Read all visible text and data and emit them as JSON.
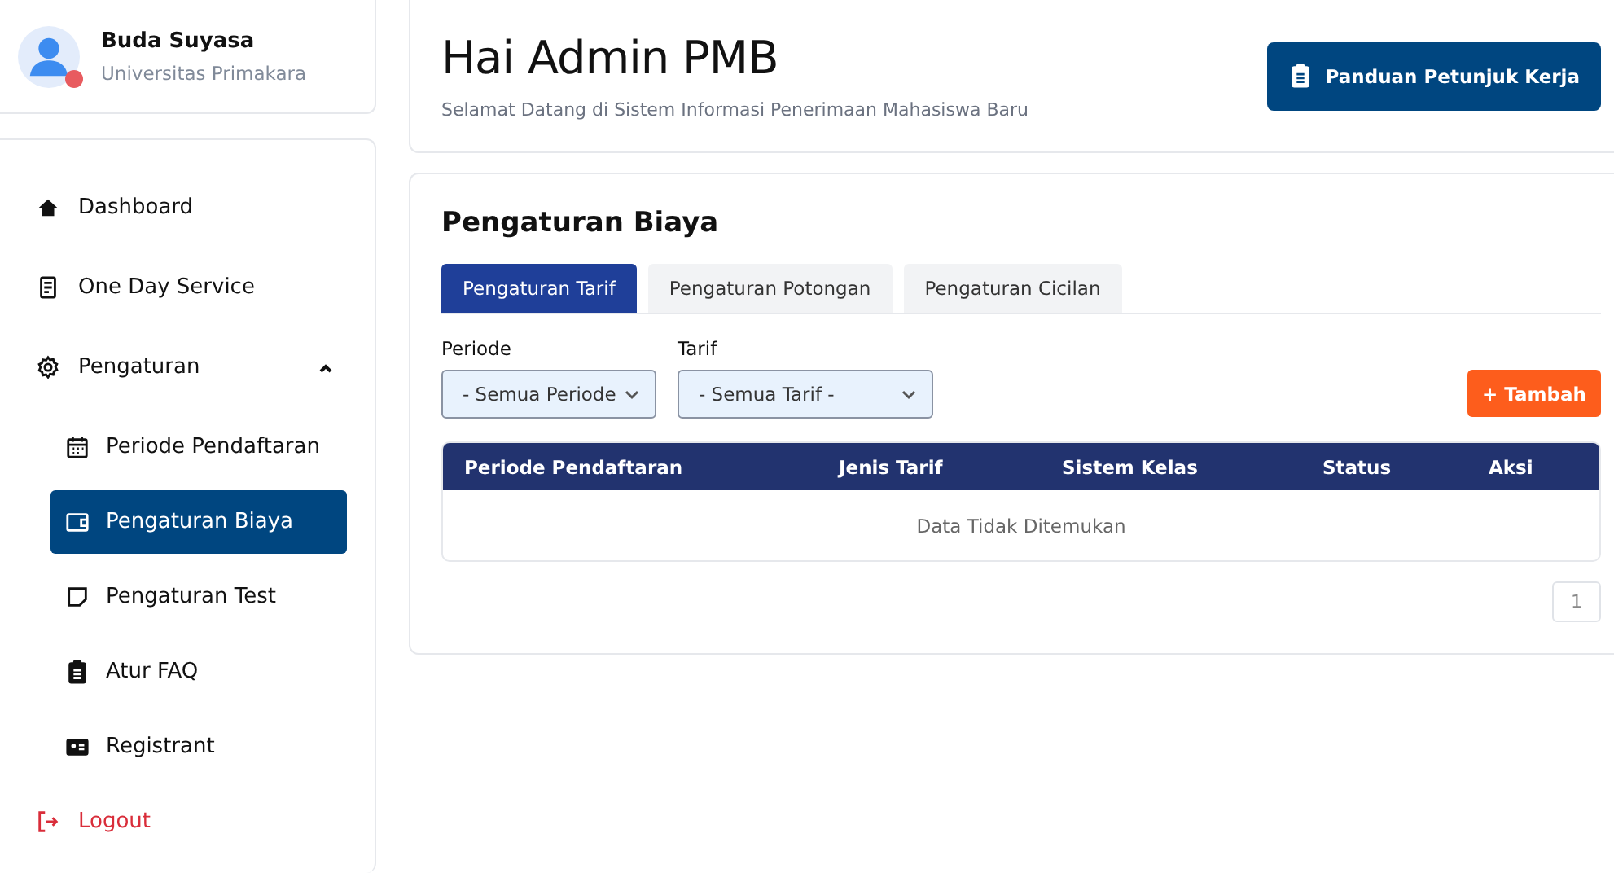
{
  "user": {
    "name": "Buda Suyasa",
    "organization": "Universitas Primakara",
    "online": false
  },
  "sidebar": {
    "items": [
      {
        "label": "Dashboard",
        "selected": false
      },
      {
        "label": "One Day Service",
        "selected": false
      },
      {
        "label": "Pengaturan",
        "selected": false,
        "expanded": true,
        "children": [
          {
            "label": "Periode Pendaftaran",
            "selected": false
          },
          {
            "label": "Pengaturan Biaya",
            "selected": true
          },
          {
            "label": "Pengaturan Test",
            "selected": false
          },
          {
            "label": "Atur FAQ",
            "selected": false
          },
          {
            "label": "Registrant",
            "selected": false
          }
        ]
      }
    ],
    "logout": "Logout"
  },
  "header": {
    "title": "Hai Admin PMB",
    "subtitle": "Selamat Datang di Sistem Informasi Penerimaan Mahasiswa Baru",
    "guide_button": "Panduan Petunjuk Kerja"
  },
  "section": {
    "title": "Pengaturan Biaya",
    "tabs": [
      {
        "label": "Pengaturan Tarif",
        "selected": true
      },
      {
        "label": "Pengaturan Potongan",
        "selected": false
      },
      {
        "label": "Pengaturan Cicilan",
        "selected": false
      }
    ],
    "filters": [
      {
        "label": "Periode",
        "value": "- Semua Periode"
      },
      {
        "label": "Tarif",
        "value": "- Semua Tarif -"
      }
    ],
    "add_button": "+ Tambah",
    "table": {
      "columns": [
        "Periode Pendaftaran",
        "Jenis Tarif",
        "Sistem Kelas",
        "Status",
        "Aksi"
      ],
      "empty_message": "Data Tidak Ditemukan"
    },
    "pagination": [
      "1"
    ]
  }
}
